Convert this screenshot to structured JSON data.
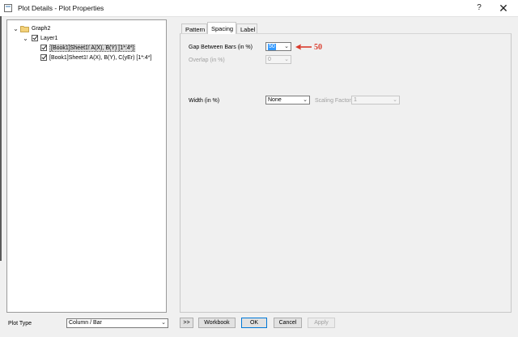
{
  "window": {
    "title": "Plot Details - Plot Properties",
    "help_label": "?",
    "close_label": "✕"
  },
  "tree": {
    "graph_label": "Graph2",
    "layer_label": "Layer1",
    "plot1_label": "[Book1]Sheet1! A(X), B(Y) [1*:4*]",
    "plot2_label": "[Book1]Sheet1! A(X), B(Y), C(yEr) [1*:4*]"
  },
  "tabs": {
    "pattern": "Pattern",
    "spacing": "Spacing",
    "label": "Label",
    "active": "Spacing"
  },
  "spacing": {
    "gap_label": "Gap Between Bars (in %)",
    "gap_value": "50",
    "overlap_label": "Overlap (in %)",
    "overlap_value": "0",
    "width_label": "Width (in %)",
    "width_value": "None",
    "scaling_label": "Scaling Factor",
    "scaling_value": "1"
  },
  "annotation": {
    "text": "50",
    "color": "#d93a2b"
  },
  "bottom": {
    "plot_type_label": "Plot Type",
    "plot_type_value": "Column / Bar",
    "expand_label": ">>",
    "workbook_label": "Workbook",
    "ok_label": "OK",
    "cancel_label": "Cancel",
    "apply_label": "Apply"
  },
  "icons": [
    "app-icon",
    "folder-icon",
    "chevron-down-icon",
    "checkbox-icon",
    "arrow-left-icon",
    "close-icon"
  ]
}
